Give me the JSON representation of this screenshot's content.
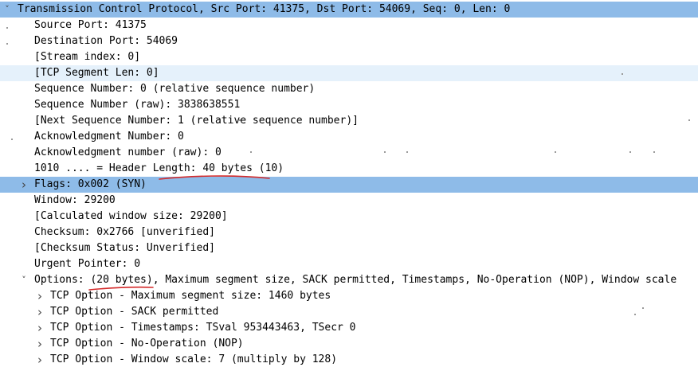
{
  "tree": [
    {
      "text": "Transmission Control Protocol, Src Port: 41375, Dst Port: 54069, Seq: 0, Len: 0",
      "level": 0,
      "arrow": "expanded",
      "style": "selected"
    },
    {
      "text": "Source Port: 41375",
      "level": 1
    },
    {
      "text": "Destination Port: 54069",
      "level": 1
    },
    {
      "text": "[Stream index: 0]",
      "level": 1
    },
    {
      "text": "[TCP Segment Len: 0]",
      "level": 1,
      "style": "light"
    },
    {
      "text": "Sequence Number: 0    (relative sequence number)",
      "level": 1
    },
    {
      "text": "Sequence Number (raw): 3838638551",
      "level": 1
    },
    {
      "text": "[Next Sequence Number: 1    (relative sequence number)]",
      "level": 1
    },
    {
      "text": "Acknowledgment Number: 0",
      "level": 1
    },
    {
      "text": "Acknowledgment number (raw): 0",
      "level": 1
    },
    {
      "text": "1010 .... = Header Length: 40 bytes (10)",
      "level": 1
    },
    {
      "text": "Flags: 0x002 (SYN)",
      "level": 1,
      "arrow": "collapsed",
      "style": "selected"
    },
    {
      "text": "Window: 29200",
      "level": 1
    },
    {
      "text": "[Calculated window size: 29200]",
      "level": 1
    },
    {
      "text": "Checksum: 0x2766 [unverified]",
      "level": 1
    },
    {
      "text": "[Checksum Status: Unverified]",
      "level": 1
    },
    {
      "text": "Urgent Pointer: 0",
      "level": 1
    },
    {
      "text": "Options: (20 bytes), Maximum segment size, SACK permitted, Timestamps, No-Operation (NOP), Window scale",
      "level": 1,
      "arrow": "expanded"
    },
    {
      "text": "TCP Option - Maximum segment size: 1460 bytes",
      "level": 2,
      "arrow": "collapsed"
    },
    {
      "text": "TCP Option - SACK permitted",
      "level": 2,
      "arrow": "collapsed"
    },
    {
      "text": "TCP Option - Timestamps: TSval 953443463, TSecr 0",
      "level": 2,
      "arrow": "collapsed"
    },
    {
      "text": "TCP Option - No-Operation (NOP)",
      "level": 2,
      "arrow": "collapsed"
    },
    {
      "text": "TCP Option - Window scale: 7 (multiply by 128)",
      "level": 2,
      "arrow": "collapsed"
    }
  ],
  "colors": {
    "selected": "#8ebbe8",
    "light": "#e5f1fb",
    "annotation": "#d42a2a"
  }
}
